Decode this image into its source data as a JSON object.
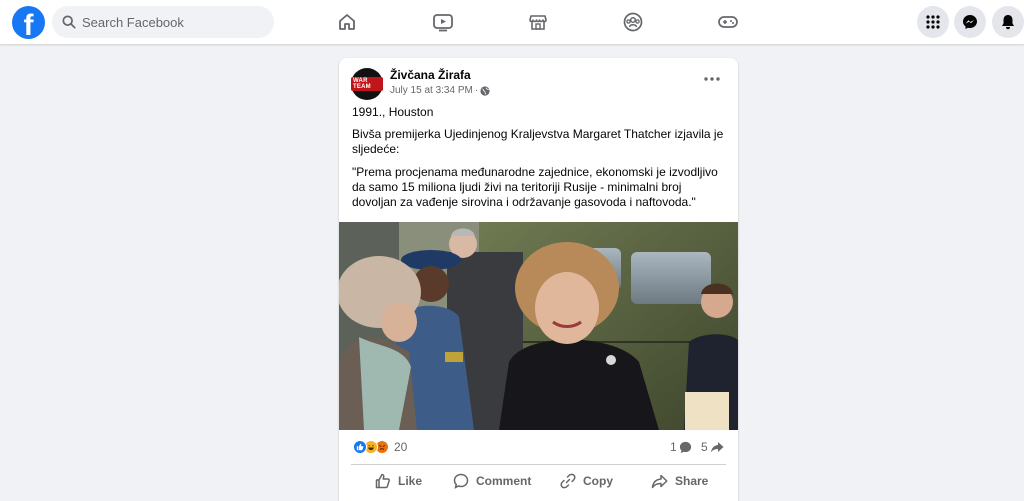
{
  "topbar": {
    "logo": "f",
    "search_placeholder": "Search Facebook",
    "nav_icons": [
      "home-icon",
      "watch-icon",
      "marketplace-icon",
      "groups-icon",
      "gaming-icon"
    ],
    "right_icons": [
      "menu-grid-icon",
      "messenger-icon",
      "notifications-icon"
    ],
    "accent_color": "#1877f2"
  },
  "post": {
    "author": "Živčana Žirafa",
    "avatar_label": "WAR TEAM",
    "timestamp": "July 15 at 3:34 PM",
    "separator": "·",
    "privacy_icon": "globe-icon",
    "paragraphs": [
      "1991., Houston",
      "Bivša premijerka Ujedinjenog Kraljevstva Margaret Thatcher izjavila je sljedeće:",
      "\"Prema procjenama međunarodne zajednice, ekonomski je izvodljivo da samo 15 miliona ljudi živi na teritoriji Rusije - minimalni broj dovoljan za vađenje sirovina i održavanje gasovoda i naftovoda.\""
    ],
    "reactions": {
      "types": [
        "like",
        "haha",
        "angry"
      ],
      "count": "20",
      "comments": "1",
      "shares": "5"
    },
    "actions": {
      "like": "Like",
      "comment": "Comment",
      "copy": "Copy",
      "share": "Share"
    }
  }
}
